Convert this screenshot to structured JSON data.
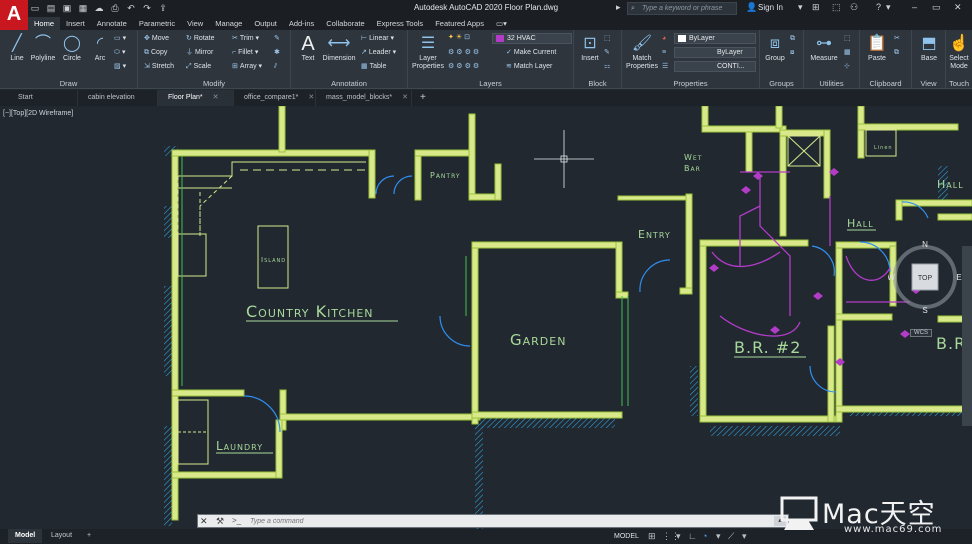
{
  "title_bar": {
    "window_title": "Autodesk AutoCAD 2020    Floor Plan.dwg",
    "search_placeholder": "Type a keyword or phrase",
    "sign_in": "Sign In",
    "logo_letter": "A"
  },
  "ribbon_tabs": [
    "Home",
    "Insert",
    "Annotate",
    "Parametric",
    "View",
    "Manage",
    "Output",
    "Add-ins",
    "Collaborate",
    "Express Tools",
    "Featured Apps"
  ],
  "ribbon": {
    "draw": {
      "title": "Draw",
      "line": "Line",
      "polyline": "Polyline",
      "circle": "Circle",
      "arc": "Arc"
    },
    "modify": {
      "title": "Modify",
      "move": "Move",
      "rotate": "Rotate",
      "trim": "Trim",
      "copy": "Copy",
      "mirror": "Mirror",
      "fillet": "Fillet",
      "stretch": "Stretch",
      "scale": "Scale",
      "array": "Array"
    },
    "annotation": {
      "title": "Annotation",
      "text": "Text",
      "dimension": "Dimension",
      "linear": "Linear",
      "leader": "Leader",
      "table": "Table"
    },
    "layers": {
      "title": "Layers",
      "layer_properties": "Layer\nProperties",
      "current_layer": "32 HVAC",
      "make_current": "Make Current",
      "match_layer": "Match Layer"
    },
    "block": {
      "title": "Block",
      "insert": "Insert"
    },
    "properties": {
      "title": "Properties",
      "match_properties": "Match\nProperties",
      "color": "ByLayer",
      "lineweight": "ByLayer",
      "linetype": "CONTI..."
    },
    "groups": {
      "title": "Groups",
      "group": "Group"
    },
    "utilities": {
      "title": "Utilities",
      "measure": "Measure"
    },
    "clipboard": {
      "title": "Clipboard",
      "paste": "Paste"
    },
    "view": {
      "title": "View",
      "base": "Base"
    },
    "touch": {
      "title": "Touch",
      "select_mode": "Select\nMode"
    }
  },
  "file_tabs": [
    {
      "label": "Start",
      "active": false,
      "closable": false
    },
    {
      "label": "cabin elevation",
      "active": false,
      "closable": false
    },
    {
      "label": "Floor Plan*",
      "active": true,
      "closable": true
    },
    {
      "label": "office_compare1*",
      "active": false,
      "closable": true
    },
    {
      "label": "mass_model_blocks*",
      "active": false,
      "closable": true
    }
  ],
  "viewport_label": "[−][Top][2D Wireframe]",
  "rooms": {
    "kitchen": "Country Kitchen",
    "island": "Island",
    "pantry": "Pantry",
    "garden": "Garden",
    "laundry": "Laundry",
    "entry": "Entry",
    "wet_bar": [
      "Wet",
      "Bar"
    ],
    "hall": "Hall",
    "hall2": "Hall",
    "br2": "B.R. #2",
    "br_partial": "B.R.",
    "linen": "Linen"
  },
  "viewcube": {
    "top": "TOP",
    "n": "N",
    "s": "S",
    "e": "E",
    "w": "W",
    "wcs": "WCS"
  },
  "command_line": {
    "placeholder": "Type a command",
    "prompt": ">_"
  },
  "status_bar": {
    "layout_tabs": [
      "Model",
      "Layout"
    ],
    "model": "MODEL"
  },
  "watermark": {
    "brand": "Mac天空",
    "url": "www.mac69.com"
  },
  "colors": {
    "wall": "#d8e88a",
    "wall_edge": "#9ac43a",
    "hatch": "#2f9fd8",
    "door": "#2f8ff0",
    "dims": "#a8d89a",
    "hvac": "#b23cc8",
    "background": "#212830"
  }
}
